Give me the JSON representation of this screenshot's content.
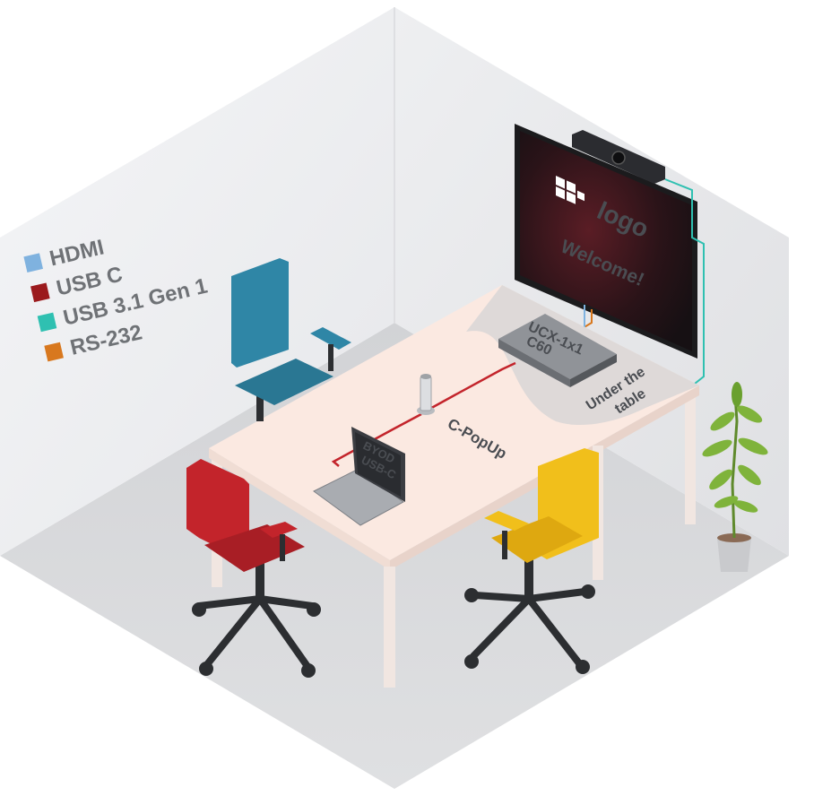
{
  "legend": {
    "items": [
      {
        "label": "HDMI",
        "color": "#7fb2df"
      },
      {
        "label": "USB C",
        "color": "#9b1a1d"
      },
      {
        "label": "USB 3.1 Gen 1",
        "color": "#2fc0b1"
      },
      {
        "label": "RS-232",
        "color": "#d8781e"
      }
    ]
  },
  "display": {
    "logo_text": "logo",
    "message": "Welcome!"
  },
  "devices": {
    "switcher_line1": "UCX-1x1",
    "switcher_line2": "C60",
    "popup_label": "C-PopUp",
    "under_table_line1": "Under the",
    "under_table_line2": "table",
    "laptop_line1": "BYOD",
    "laptop_line2": "USB-C"
  },
  "colors": {
    "hdmi": "#7fb2df",
    "usb_c": "#9b1a1d",
    "usb31": "#2fc0b1",
    "rs232": "#d8781e",
    "chair_blue": "#2f86a6",
    "chair_red": "#c3242b",
    "chair_yellow": "#f1bf1b",
    "table_top": "#fbe9e1"
  }
}
